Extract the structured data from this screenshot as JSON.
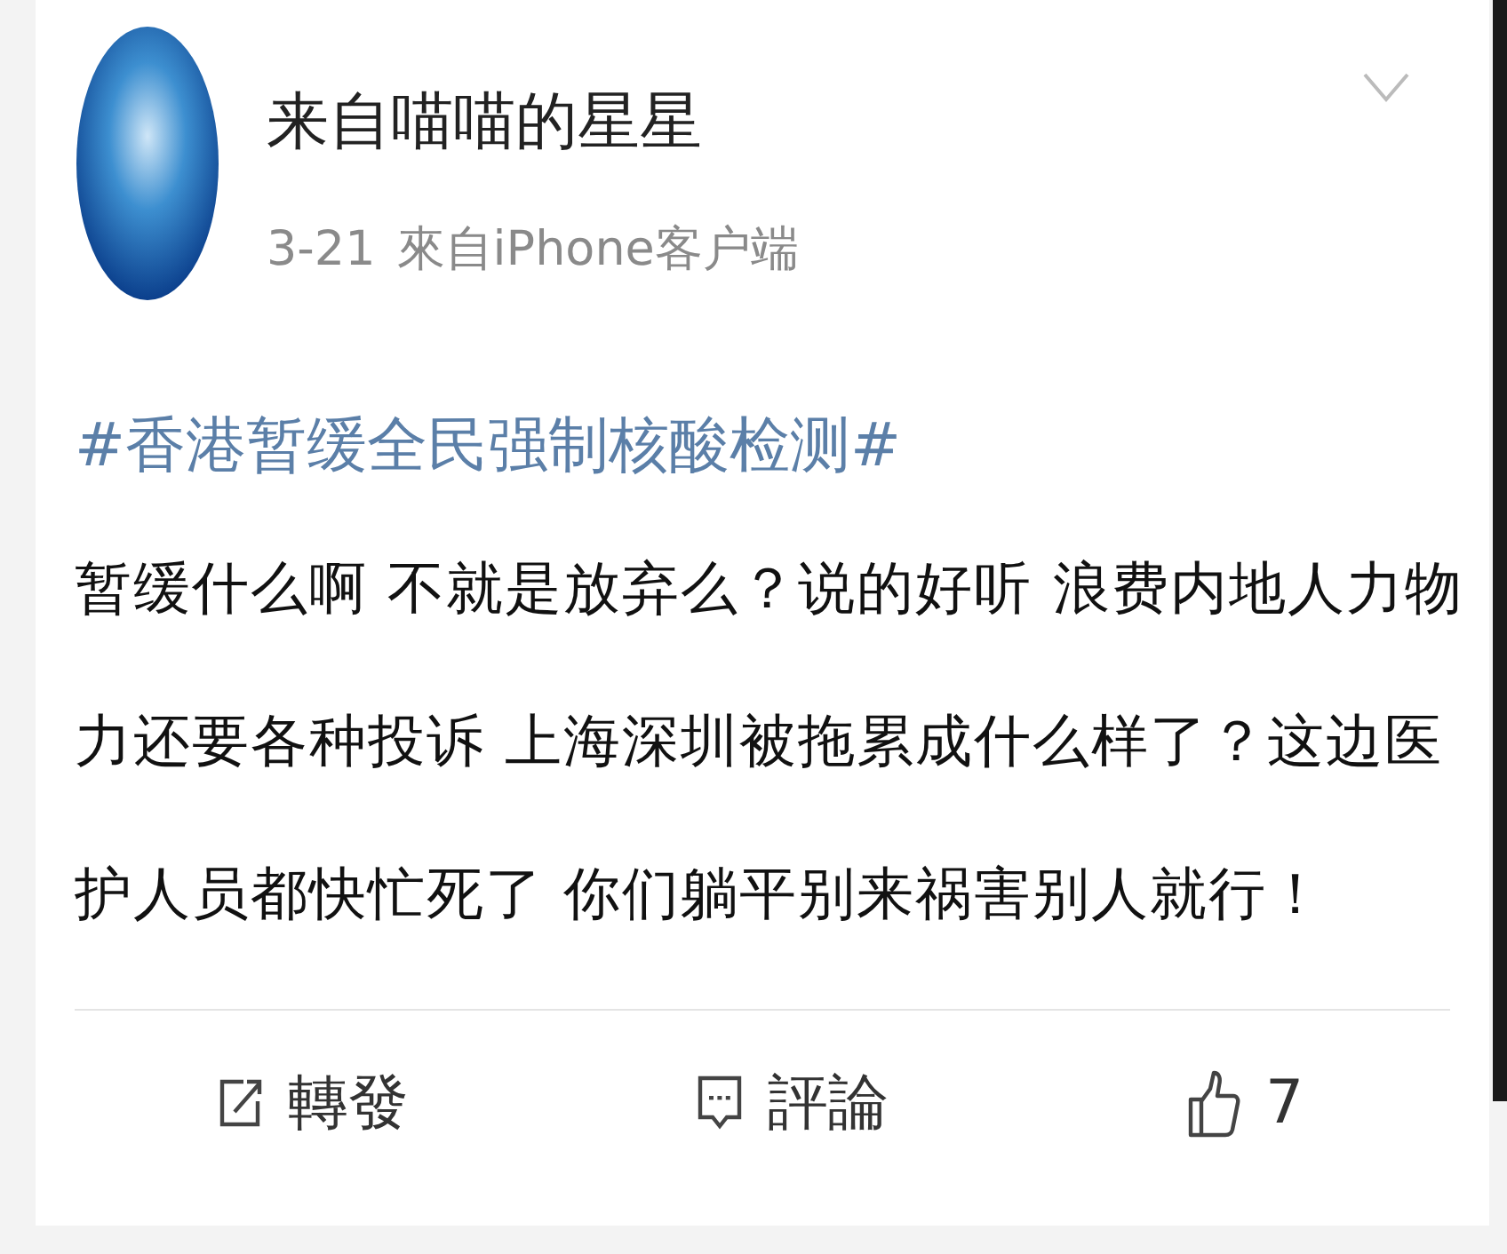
{
  "author": {
    "name": "来自喵喵的星星",
    "time": "3-21",
    "source": "來自iPhone客户端"
  },
  "post": {
    "hashtag": "#香港暂缓全民强制核酸检测#",
    "text": "暂缓什么啊 不就是放弃么？说的好听 浪费内地人力物力还要各种投诉 上海深圳被拖累成什么样了？这边医护人员都快忙死了 你们躺平别来祸害别人就行！"
  },
  "actions": [
    {
      "kind": "repost",
      "label": "轉發"
    },
    {
      "kind": "comment",
      "label": "評論"
    },
    {
      "kind": "like",
      "label": "7"
    }
  ]
}
